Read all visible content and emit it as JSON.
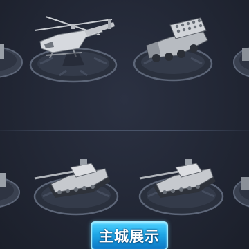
{
  "screen": {
    "title": "",
    "divider": true
  },
  "units": [
    {
      "row": 1,
      "kind": "partial",
      "icon": "unit-partial-icon"
    },
    {
      "row": 1,
      "kind": "helicopter",
      "icon": "helicopter-icon"
    },
    {
      "row": 1,
      "kind": "missile-launcher-truck",
      "icon": "missile-launcher-icon"
    },
    {
      "row": 1,
      "kind": "partial",
      "icon": "unit-partial-icon"
    },
    {
      "row": 2,
      "kind": "partial",
      "icon": "unit-partial-icon"
    },
    {
      "row": 2,
      "kind": "tank",
      "icon": "tank-icon"
    },
    {
      "row": 2,
      "kind": "tank",
      "icon": "tank-icon"
    },
    {
      "row": 2,
      "kind": "partial",
      "icon": "unit-partial-icon"
    }
  ],
  "buttons": {
    "main_city_display_label": "主城展示"
  },
  "colors": {
    "background": "#222735",
    "pedestal": "#3a4150",
    "pedestal_ring": "#5d6678",
    "button_top": "#4fd2ff",
    "button_bottom": "#0c77c4",
    "button_border": "#9ce9ff"
  }
}
